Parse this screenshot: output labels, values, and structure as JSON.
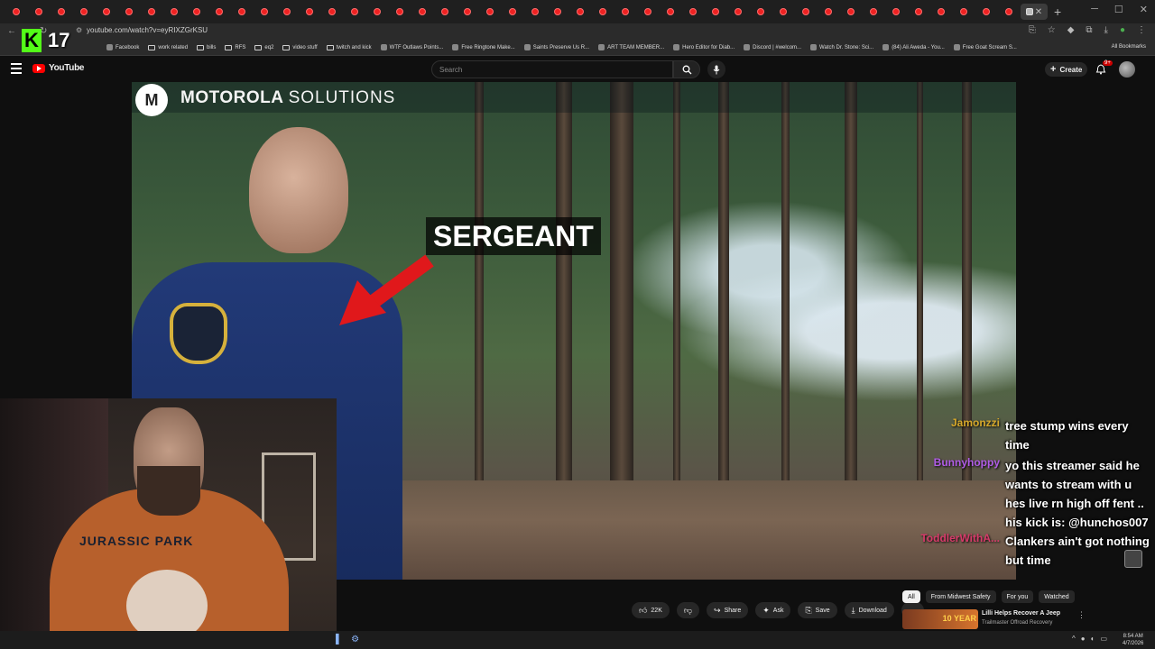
{
  "browser": {
    "url": "youtube.com/watch?v=eyRIXZGrKSU",
    "bookmarks": [
      {
        "label": "Facebook",
        "type": "site"
      },
      {
        "label": "work related",
        "type": "folder"
      },
      {
        "label": "bills",
        "type": "folder"
      },
      {
        "label": "RFS",
        "type": "folder"
      },
      {
        "label": "eq2",
        "type": "folder"
      },
      {
        "label": "video stuff",
        "type": "folder"
      },
      {
        "label": "twitch and kick",
        "type": "folder"
      },
      {
        "label": "WTF Outlaws Points...",
        "type": "site"
      },
      {
        "label": "Free Ringtone Make...",
        "type": "site"
      },
      {
        "label": "Saints Preserve Us R...",
        "type": "site"
      },
      {
        "label": "ART TEAM MEMBER...",
        "type": "site"
      },
      {
        "label": "Hero Editor for Diab...",
        "type": "site"
      },
      {
        "label": "Discord | #welcom...",
        "type": "site"
      },
      {
        "label": "Watch Dr. Stone: Sci...",
        "type": "site"
      },
      {
        "label": "(84) Ali Aweda - You...",
        "type": "site"
      },
      {
        "label": "Free Goat Scream S...",
        "type": "site"
      }
    ],
    "all_bookmarks": "All Bookmarks"
  },
  "overlay": {
    "kick_letter": "K",
    "kick_count": "17"
  },
  "youtube": {
    "logo_text": "YouTube",
    "search_placeholder": "Search",
    "create_label": "Create",
    "notification_badge": "9+"
  },
  "video": {
    "brand_bold": "MOTOROLA",
    "brand_light": "SOLUTIONS",
    "caption": "SERGEANT"
  },
  "webcam": {
    "shirt_text": "JURASSIC PARK"
  },
  "chat": [
    {
      "user": "Jamonzzi",
      "color": "#d6a82a",
      "text": "tree stump wins every time"
    },
    {
      "user": "Bunnyhoppy",
      "color": "#b05ce6",
      "text": "yo this streamer said he wants to stream with u hes live rn high off fent .. his kick is: @hunchos007"
    },
    {
      "user": "ToddlerWithA...",
      "color": "#d63a6a",
      "text": "Clankers ain't got nothing but time"
    }
  ],
  "actions": {
    "likes": "22K",
    "share": "Share",
    "ask": "Ask",
    "save": "Save",
    "download": "Download"
  },
  "chips": [
    "All",
    "From Midwest Safety",
    "For you",
    "Watched"
  ],
  "recommendation": {
    "title": "Lilli Helps Recover A Jeep",
    "channel": "Trailmaster Offroad Recovery",
    "thumb_badge": "10 YEAR"
  },
  "taskbar": {
    "time": "8:54 AM",
    "date": "4/7/2026"
  }
}
